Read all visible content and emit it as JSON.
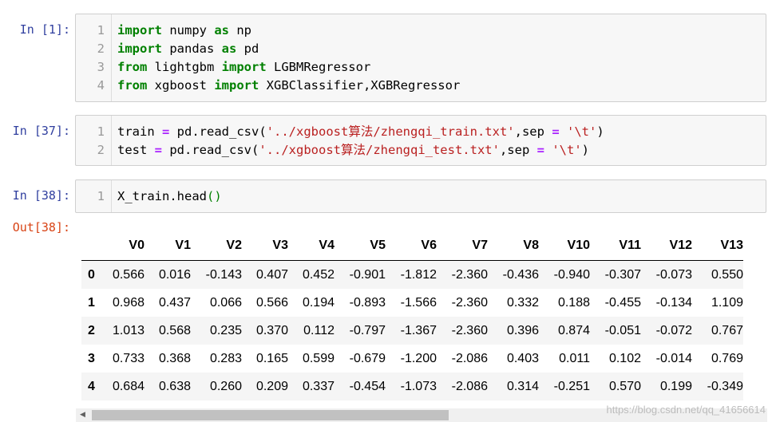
{
  "cells": [
    {
      "prompt": "In [1]:",
      "lines": [
        {
          "num": "1",
          "tokens": [
            [
              "kw",
              "import"
            ],
            [
              "p",
              " numpy "
            ],
            [
              "kw",
              "as"
            ],
            [
              "p",
              " np"
            ]
          ]
        },
        {
          "num": "2",
          "tokens": [
            [
              "kw",
              "import"
            ],
            [
              "p",
              " pandas "
            ],
            [
              "kw",
              "as"
            ],
            [
              "p",
              " pd"
            ]
          ]
        },
        {
          "num": "3",
          "tokens": [
            [
              "kw",
              "from"
            ],
            [
              "p",
              " lightgbm "
            ],
            [
              "kw",
              "import"
            ],
            [
              "p",
              " LGBMRegressor"
            ]
          ]
        },
        {
          "num": "4",
          "tokens": [
            [
              "kw",
              "from"
            ],
            [
              "p",
              " xgboost "
            ],
            [
              "kw",
              "import"
            ],
            [
              "p",
              " XGBClassifier,XGBRegressor"
            ]
          ]
        }
      ]
    },
    {
      "prompt": "In [37]:",
      "lines": [
        {
          "num": "1",
          "tokens": [
            [
              "p",
              "train "
            ],
            [
              "op",
              "="
            ],
            [
              "p",
              " pd.read_csv("
            ],
            [
              "st",
              "'../xgboost算法/zhengqi_train.txt'"
            ],
            [
              "p",
              ",sep "
            ],
            [
              "op",
              "="
            ],
            [
              "p",
              " "
            ],
            [
              "st",
              "'\\t'"
            ],
            [
              "p",
              ")"
            ]
          ]
        },
        {
          "num": "2",
          "tokens": [
            [
              "p",
              "test "
            ],
            [
              "op",
              "="
            ],
            [
              "p",
              " pd.read_csv("
            ],
            [
              "st",
              "'../xgboost算法/zhengqi_test.txt'"
            ],
            [
              "p",
              ",sep "
            ],
            [
              "op",
              "="
            ],
            [
              "p",
              " "
            ],
            [
              "st",
              "'\\t'"
            ],
            [
              "p",
              ")"
            ]
          ]
        }
      ]
    },
    {
      "prompt": "In [38]:",
      "lines": [
        {
          "num": "1",
          "tokens": [
            [
              "p",
              "X_train.head"
            ],
            [
              "paren",
              "()"
            ]
          ]
        }
      ]
    }
  ],
  "output_prompt": "Out[38]:",
  "dataframe": {
    "columns": [
      "V0",
      "V1",
      "V2",
      "V3",
      "V4",
      "V5",
      "V6",
      "V7",
      "V8",
      "V10",
      "V11",
      "V12",
      "V13"
    ],
    "index": [
      "0",
      "1",
      "2",
      "3",
      "4"
    ],
    "rows": [
      [
        "0.566",
        "0.016",
        "-0.143",
        "0.407",
        "0.452",
        "-0.901",
        "-1.812",
        "-2.360",
        "-0.436",
        "-0.940",
        "-0.307",
        "-0.073",
        "0.550"
      ],
      [
        "0.968",
        "0.437",
        "0.066",
        "0.566",
        "0.194",
        "-0.893",
        "-1.566",
        "-2.360",
        "0.332",
        "0.188",
        "-0.455",
        "-0.134",
        "1.109"
      ],
      [
        "1.013",
        "0.568",
        "0.235",
        "0.370",
        "0.112",
        "-0.797",
        "-1.367",
        "-2.360",
        "0.396",
        "0.874",
        "-0.051",
        "-0.072",
        "0.767"
      ],
      [
        "0.733",
        "0.368",
        "0.283",
        "0.165",
        "0.599",
        "-0.679",
        "-1.200",
        "-2.086",
        "0.403",
        "0.011",
        "0.102",
        "-0.014",
        "0.769"
      ],
      [
        "0.684",
        "0.638",
        "0.260",
        "0.209",
        "0.337",
        "-0.454",
        "-1.073",
        "-2.086",
        "0.314",
        "-0.251",
        "0.570",
        "0.199",
        "-0.349"
      ]
    ]
  },
  "scrollbar": {
    "left_arrow_icon": "triangle-left-icon",
    "scroll_fraction": 0.53
  },
  "watermark": "https://blog.csdn.net/qq_41656614"
}
